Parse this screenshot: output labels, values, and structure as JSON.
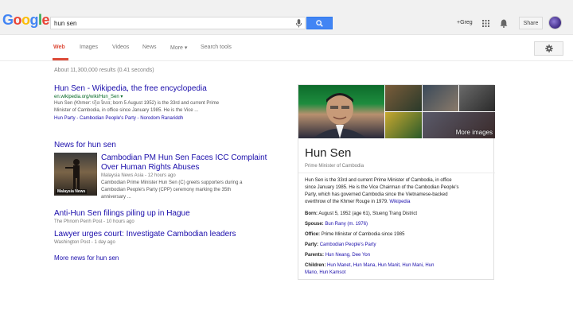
{
  "header": {
    "logo": "Google",
    "search_value": "hun sen",
    "user_link": "+Greg",
    "share_label": "Share"
  },
  "nav": {
    "tabs": [
      "Web",
      "Images",
      "Videos",
      "News",
      "More ▾",
      "Search tools"
    ]
  },
  "stats": "About 11,300,000 results (0.41 seconds)",
  "results": [
    {
      "title": "Hun Sen - Wikipedia, the free encyclopedia",
      "url": "en.wikipedia.org/wiki/Hun_Sen ▾",
      "snippet_1": "Hun Sen (Khmer: ហ៊ុន សែន; born 5 August 1952) is the 33rd and current Prime",
      "snippet_2": "Minister of Cambodia, in office since January 1985. He is the Vice ...",
      "links": "Hun Party - Cambodian People's Party - Norodom Ranariddh"
    }
  ],
  "news": {
    "header": "News for hun sen",
    "thumb_label": "Malaysia News",
    "items": [
      {
        "title_1": "Cambodian PM Hun Sen Faces ICC Complaint",
        "title_2": "Over Human Rights Abuses",
        "meta": "Malaysia News Asia - 12 hours ago",
        "snippet_1": "Cambodian Prime Minister Hun Sen (C) greets supporters during a",
        "snippet_2": "Cambodian People's Party (CPP) ceremony marking the 35th",
        "snippet_3": "anniversary ..."
      },
      {
        "title": "Anti-Hun Sen filings piling up in Hague",
        "meta": "The Phnom Penh Post - 10 hours ago"
      },
      {
        "title": "Lawyer urges court: Investigate Cambodian leaders",
        "meta": "Washington Post - 1 day ago"
      }
    ],
    "more": "More news for hun sen"
  },
  "knowledge_panel": {
    "more_images": "More images",
    "name": "Hun Sen",
    "subtitle": "Prime Minister of Cambodia",
    "desc_1": "Hun Sen is the 33rd and current Prime Minister of Cambodia, in office",
    "desc_2": "since January 1985. He is the Vice Chairman of the Cambodian People's",
    "desc_3": "Party, which has governed Cambodia since the Vietnamese-backed",
    "desc_4": "overthrow of the Khmer Rouge in 1979.",
    "desc_link": "Wikipedia",
    "facts": [
      {
        "label": "Born:",
        "value": "August 5, 1952 (age 61), Stueng Trang District"
      },
      {
        "label": "Spouse:",
        "value": "Bun Rany (m. 1976)"
      },
      {
        "label": "Office:",
        "value": "Prime Minister of Cambodia since 1985"
      },
      {
        "label": "Party:",
        "value": "Cambodian People's Party"
      },
      {
        "label": "Parents:",
        "value": "Hun Neang, Dee Yon"
      },
      {
        "label": "Children:",
        "value": "Hun Manet, Hun Mana, Hun Manit, Hun Mani, Hun",
        "value_2": "Mano, Hun Kamsot"
      }
    ]
  },
  "colors": {
    "link": "#1a0dab",
    "url": "#006621",
    "active_tab": "#dd4b39",
    "search_button": "#4285f4"
  }
}
